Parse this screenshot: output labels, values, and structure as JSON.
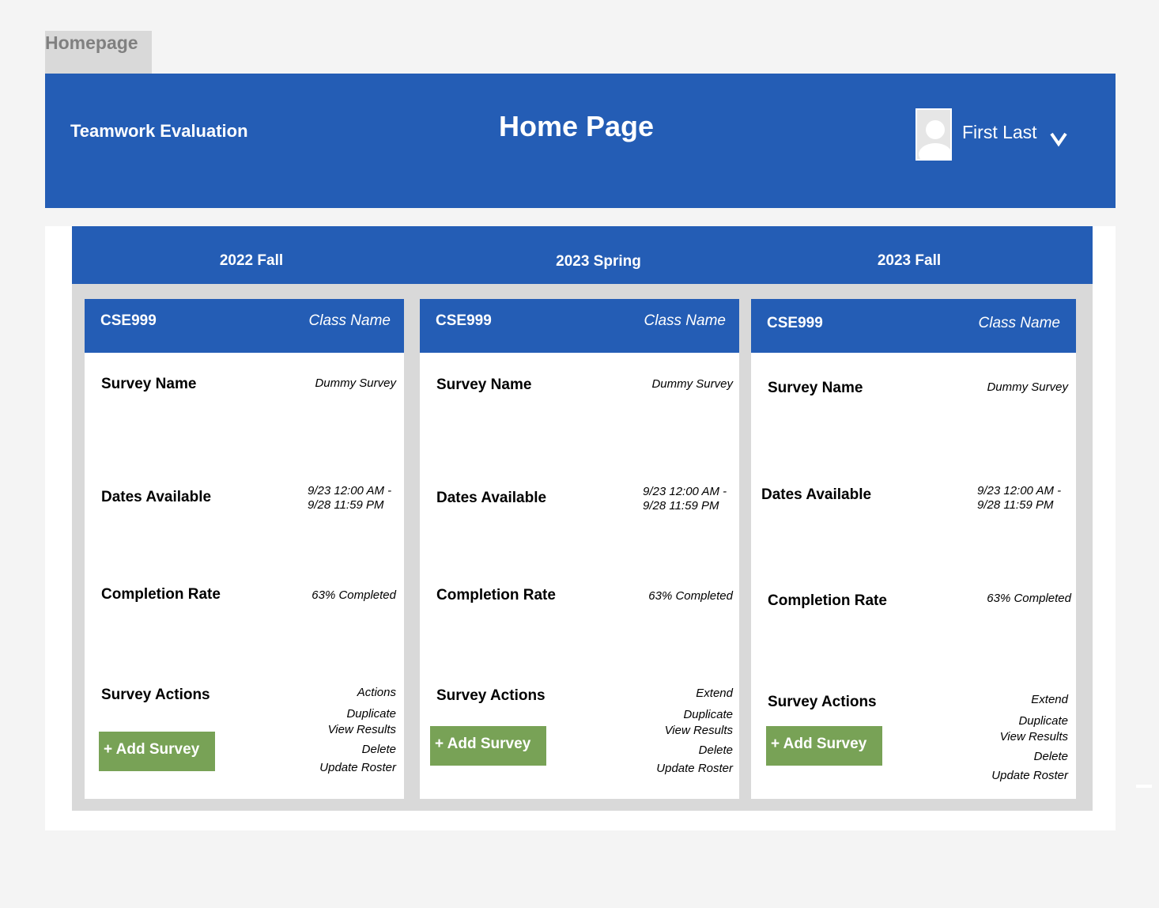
{
  "frame_label": "Homepage",
  "header": {
    "app_name": "Teamwork Evaluation",
    "page_title": "Home Page",
    "user_name": "First Last",
    "avatar_icon": "user-avatar-icon",
    "dropdown_icon": "chevron-down-icon"
  },
  "semesters": [
    "2022 Fall",
    "2023 Spring",
    "2023 Fall"
  ],
  "labels": {
    "survey_name": "Survey Name",
    "dates_available": "Dates Available",
    "completion_rate": "Completion Rate",
    "survey_actions": "Survey Actions",
    "add_survey": "+ Add Survey"
  },
  "cards": [
    {
      "course_code": "CSE999",
      "class_name": "Class Name",
      "survey_name": "Dummy Survey",
      "dates_line1": "9/23 12:00 AM -",
      "dates_line2": "9/28 11:59 PM",
      "completion": "63% Completed",
      "actions": [
        "Actions",
        "Duplicate",
        "View Results",
        "Delete",
        "Update Roster"
      ]
    },
    {
      "course_code": "CSE999",
      "class_name": "Class Name",
      "survey_name": "Dummy Survey",
      "dates_line1": "9/23 12:00 AM -",
      "dates_line2": "9/28 11:59 PM",
      "completion": "63% Completed",
      "actions": [
        "Extend",
        "Duplicate",
        "View Results",
        "Delete",
        "Update Roster"
      ]
    },
    {
      "course_code": "CSE999",
      "class_name": "Class Name",
      "survey_name": "Dummy Survey",
      "dates_line1": "9/23 12:00 AM -",
      "dates_line2": "9/28 11:59 PM",
      "completion": "63% Completed",
      "actions": [
        "Extend",
        "Duplicate",
        "View Results",
        "Delete",
        "Update Roster"
      ]
    }
  ],
  "colors": {
    "primary_blue": "#245db5",
    "add_button_green": "#78a256",
    "board_gray": "#d9d9d9"
  }
}
